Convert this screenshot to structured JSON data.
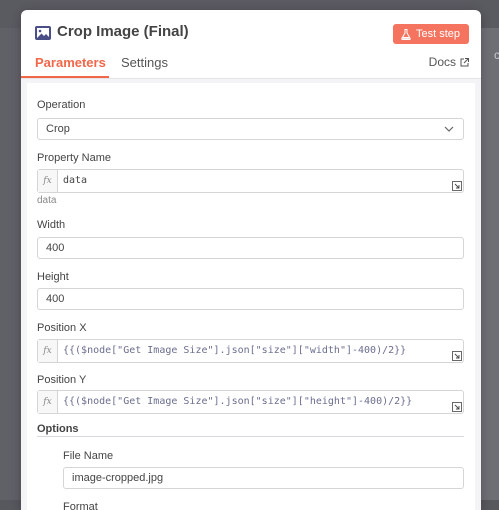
{
  "node": {
    "title": "Crop Image (Final)",
    "title_icon": "image-icon",
    "test_step_label": "Test step"
  },
  "tabs": [
    {
      "label": "Parameters",
      "active": true
    },
    {
      "label": "Settings",
      "active": false
    }
  ],
  "docs_label": "Docs",
  "fields": {
    "operation": {
      "label": "Operation",
      "value": "Crop"
    },
    "property_name": {
      "label": "Property Name",
      "value": "data",
      "hint": "data"
    },
    "width": {
      "label": "Width",
      "value": "400"
    },
    "height": {
      "label": "Height",
      "value": "400"
    },
    "position_x": {
      "label": "Position X",
      "value": "{{($node[\"Get Image Size\"].json[\"size\"][\"width\"]-400)/2}}"
    },
    "position_y": {
      "label": "Position Y",
      "value": "{{($node[\"Get Image Size\"].json[\"size\"][\"height\"]-400)/2}}"
    }
  },
  "options": {
    "label": "Options",
    "file_name": {
      "label": "File Name",
      "value": "image-cropped.jpg"
    },
    "format_label": "Format"
  },
  "colors": {
    "accent": "#f2674a",
    "test_button": "#f5745f"
  }
}
